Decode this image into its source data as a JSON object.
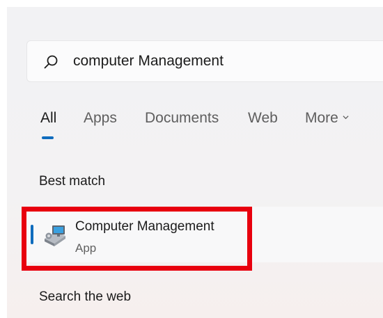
{
  "search": {
    "query": "computer Management",
    "icon": "search-icon"
  },
  "tabs": [
    {
      "label": "All",
      "active": true
    },
    {
      "label": "Apps"
    },
    {
      "label": "Documents"
    },
    {
      "label": "Web"
    },
    {
      "label": "More",
      "icon": "chevron-down-icon"
    }
  ],
  "best_match": {
    "heading": "Best match",
    "result": {
      "title": "Computer Management",
      "subtitle": "App",
      "icon": "computer-management-icon"
    }
  },
  "search_web": {
    "heading": "Search the web"
  },
  "colors": {
    "accent": "#0f6cbd",
    "highlight": "#e8000e"
  }
}
